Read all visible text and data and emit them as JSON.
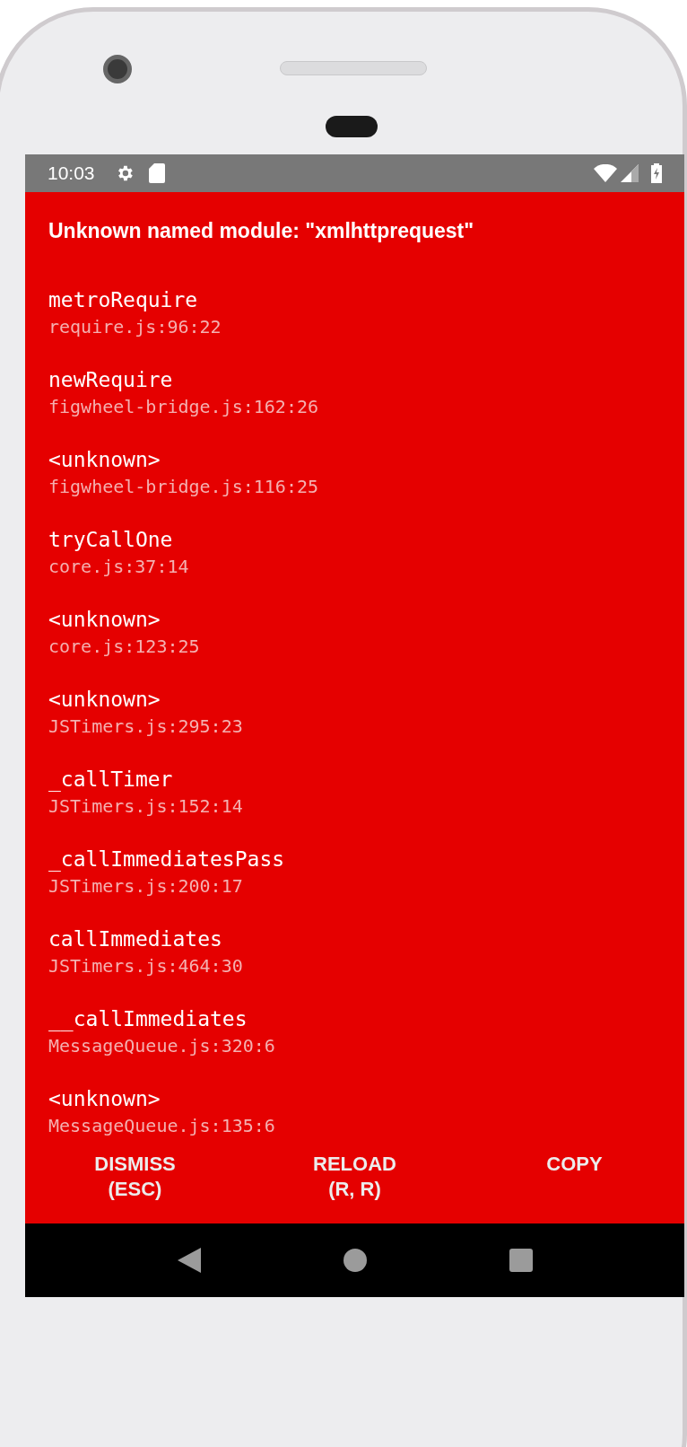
{
  "status_bar": {
    "time": "10:03"
  },
  "error": {
    "title": "Unknown named module: \"xmlhttprequest\"",
    "frames": [
      {
        "method": "metroRequire",
        "location": "require.js:96:22"
      },
      {
        "method": "newRequire",
        "location": "figwheel-bridge.js:162:26"
      },
      {
        "method": "<unknown>",
        "location": "figwheel-bridge.js:116:25"
      },
      {
        "method": "tryCallOne",
        "location": "core.js:37:14"
      },
      {
        "method": "<unknown>",
        "location": "core.js:123:25"
      },
      {
        "method": "<unknown>",
        "location": "JSTimers.js:295:23"
      },
      {
        "method": "_callTimer",
        "location": "JSTimers.js:152:14"
      },
      {
        "method": "_callImmediatesPass",
        "location": "JSTimers.js:200:17"
      },
      {
        "method": "callImmediates",
        "location": "JSTimers.js:464:30"
      },
      {
        "method": "__callImmediates",
        "location": "MessageQueue.js:320:6"
      },
      {
        "method": "<unknown>",
        "location": "MessageQueue.js:135:6"
      }
    ]
  },
  "buttons": [
    {
      "lines": [
        "DISMISS",
        "(ESC)"
      ]
    },
    {
      "lines": [
        "RELOAD",
        "(R, R)"
      ]
    },
    {
      "lines": [
        "COPY"
      ]
    }
  ]
}
